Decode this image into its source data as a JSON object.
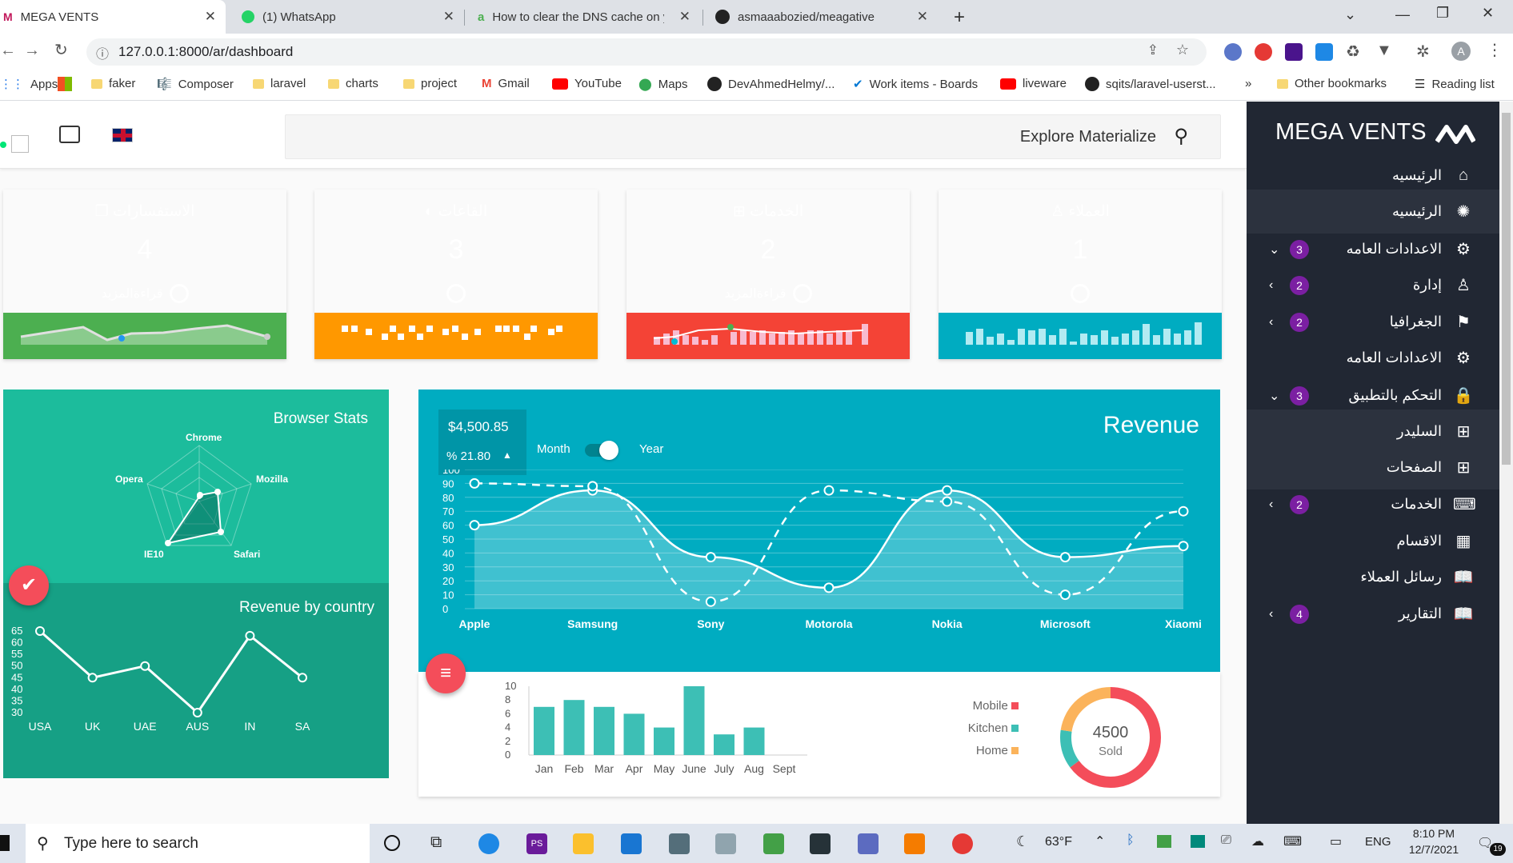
{
  "browser": {
    "tabs": [
      {
        "title": "MEGA VENTS",
        "active": true
      },
      {
        "title": "(1) WhatsApp",
        "active": false
      },
      {
        "title": "How to clear the DNS cache on y",
        "active": false
      },
      {
        "title": "asmaaabozied/meagative",
        "active": false
      }
    ],
    "url": "127.0.0.1:8000/ar/dashboard",
    "profile_initial": "A",
    "bookmarks": [
      "Apps",
      "faker",
      "Composer",
      "laravel",
      "charts",
      "project",
      "Gmail",
      "YouTube",
      "Maps",
      "DevAhmedHelmy/...",
      "Work items - Boards",
      "liveware",
      "sqits/laravel-userst..."
    ],
    "other_bookmarks": "Other bookmarks",
    "reading_list": "Reading list",
    "more_bookmarks": "»"
  },
  "header": {
    "search_placeholder": "Explore Materialize"
  },
  "sidebar": {
    "brand": "MEGA VENTS",
    "items": [
      {
        "label": "الرئيسيه",
        "icon": "home-icon",
        "sub": false
      },
      {
        "label": "الرئيسيه",
        "icon": "palette-icon",
        "sub": true
      },
      {
        "label": "الاعدادات العامه",
        "icon": "settings-icon",
        "badge": "3",
        "chevron": "⌄",
        "sub": false
      },
      {
        "label": "إدارة",
        "icon": "user-icon",
        "badge": "2",
        "chevron": "‹",
        "sub": false
      },
      {
        "label": "الجغرافيا",
        "icon": "flag-icon",
        "badge": "2",
        "chevron": "‹",
        "sub": false
      },
      {
        "label": "الاعدادات العامه",
        "icon": "settings-icon",
        "sub": false
      },
      {
        "label": "التحكم بالتطبيق",
        "icon": "lock-icon",
        "badge": "3",
        "chevron": "⌄",
        "sub": false
      },
      {
        "label": "السليدر",
        "icon": "grid-icon",
        "sub": true
      },
      {
        "label": "الصفحات",
        "icon": "grid-icon",
        "sub": true
      },
      {
        "label": "الخدمات",
        "icon": "keyboard-icon",
        "badge": "2",
        "chevron": "‹",
        "sub": false
      },
      {
        "label": "الاقسام",
        "icon": "calendar-icon",
        "sub": false
      },
      {
        "label": "رسائل العملاء",
        "icon": "book-icon",
        "sub": false
      },
      {
        "label": "التقارير",
        "icon": "book-icon",
        "badge": "4",
        "chevron": "‹",
        "sub": false
      }
    ]
  },
  "cards": [
    {
      "title": "الاستفسارات",
      "value": "4",
      "more": "قراءةالمزيد",
      "color": "#66bb6a",
      "foot": "#4caf50"
    },
    {
      "title": "القاعات",
      "value": "3",
      "more": "",
      "color": "#ffa726",
      "foot": "#ff9800"
    },
    {
      "title": "الخدمات",
      "value": "2",
      "more": "قراءةالمزيد",
      "color": "#ef5350",
      "foot": "#f44336"
    },
    {
      "title": "العملاء",
      "value": "1",
      "more": "",
      "color": "#00bcd4",
      "foot": "#00acc1"
    }
  ],
  "browser_stats": {
    "title": "Browser Stats",
    "axes": [
      "Chrome",
      "Mozilla",
      "Safari",
      "IE10",
      "Opera"
    ]
  },
  "revenue_country": {
    "title": "Revenue by country",
    "chart_data": {
      "type": "line",
      "categories": [
        "USA",
        "UK",
        "UAE",
        "AUS",
        "IN",
        "SA"
      ],
      "values": [
        65,
        45,
        50,
        30,
        63,
        45
      ],
      "yticks": [
        "65",
        "60",
        "55",
        "50",
        "45",
        "40",
        "35",
        "30"
      ],
      "ylim": [
        30,
        65
      ]
    }
  },
  "revenue": {
    "title": "Revenue",
    "amount": "$4,500.85",
    "change": "% 21.80",
    "toggle_left": "Month",
    "toggle_right": "Year",
    "chart_data": {
      "type": "line",
      "categories": [
        "Apple",
        "Samsung",
        "Sony",
        "Motorola",
        "Nokia",
        "Microsoft",
        "Xiaomi"
      ],
      "series": [
        {
          "values": [
            60,
            85,
            37,
            15,
            85,
            37,
            45
          ],
          "style": "solid"
        },
        {
          "values": [
            90,
            88,
            5,
            85,
            77,
            10,
            70
          ],
          "style": "dashed"
        }
      ],
      "yticks": [
        "100",
        "90",
        "80",
        "70",
        "60",
        "50",
        "40",
        "30",
        "20",
        "10",
        "0"
      ],
      "ylim": [
        0,
        100
      ]
    }
  },
  "monthly": {
    "chart_data": {
      "type": "bar",
      "categories": [
        "Jan",
        "Feb",
        "Mar",
        "Apr",
        "May",
        "June",
        "July",
        "Aug",
        "Sept"
      ],
      "values": [
        7,
        8,
        7,
        6,
        4,
        10,
        3,
        4,
        0
      ],
      "yticks": [
        "10",
        "8",
        "6",
        "4",
        "2",
        "0"
      ],
      "ylim": [
        0,
        10
      ]
    }
  },
  "donut": {
    "value": "4500",
    "label": "Sold",
    "legend": [
      {
        "name": "Mobile",
        "color": "#f44d5a"
      },
      {
        "name": "Kitchen",
        "color": "#3dbfb5"
      },
      {
        "name": "Home",
        "color": "#fbb35b"
      }
    ]
  },
  "taskbar": {
    "search_placeholder": "Type here to search",
    "weather": "63°F",
    "lang": "ENG",
    "time": "8:10 PM",
    "date": "12/7/2021",
    "notifications": "19"
  }
}
